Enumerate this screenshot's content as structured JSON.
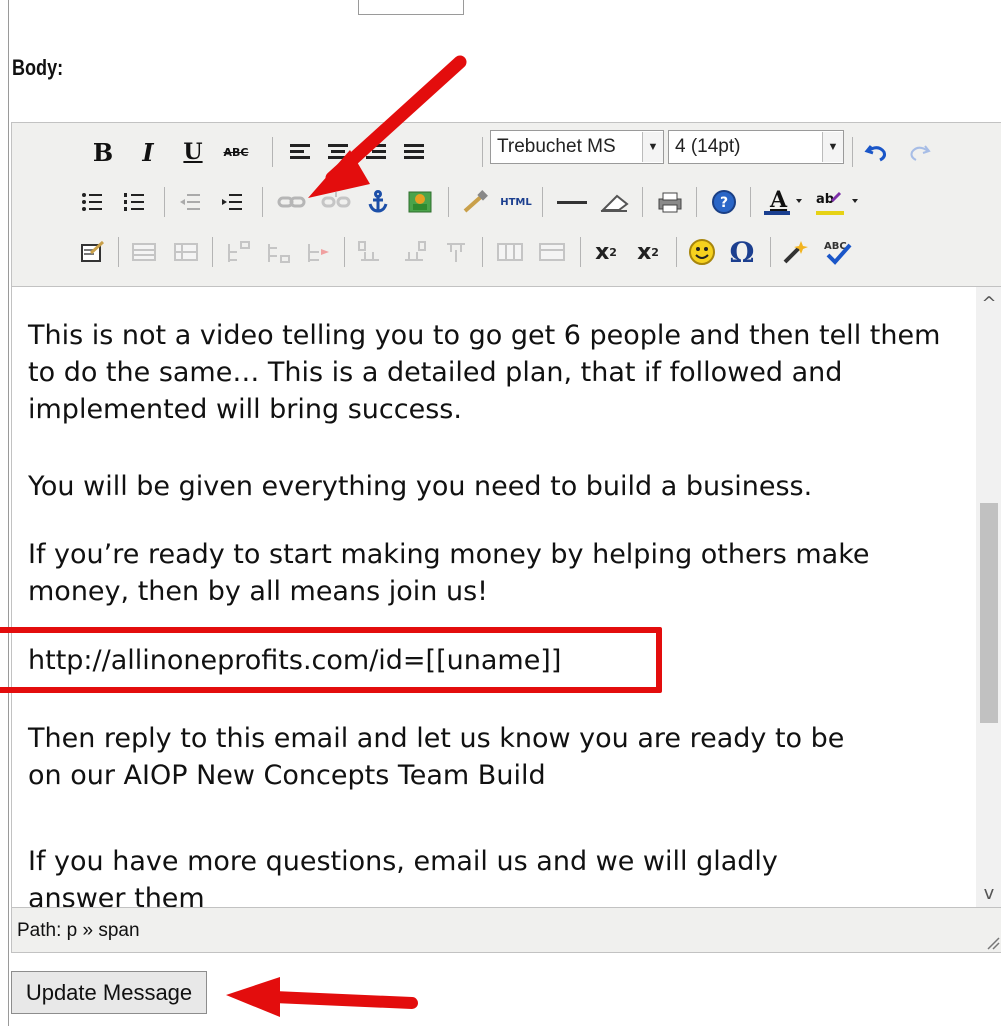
{
  "top": {
    "cut_label": "...",
    "cut_tail": "' ' ' ' (        )"
  },
  "body_label": "Body:",
  "toolbar": {
    "bold": "B",
    "italic": "I",
    "underline": "U",
    "strike": "ABC",
    "font_family": "Trebuchet MS",
    "font_size": "4 (14pt)",
    "html_label": "HTML",
    "abc_label": "ABC"
  },
  "content": {
    "p1": "This is not a video telling you to go get 6 people and then tell them to do the same… This is a detailed plan, that if followed and implemented will bring success.",
    "p2": "You will be given everything you need to build a business.",
    "p3": "If you’re ready to start making money by helping others make money, then by all means join us!",
    "p4": "http://allinoneprofits.com/id=[[uname]]",
    "p5": "Then  reply to this email and let us know you are ready to be on our AIOP New Concepts Team Build",
    "p6": "If you have more questions, email us and we will gladly answer them"
  },
  "path_text": "Path: p » span",
  "update_button": "Update Message",
  "colors": {
    "annotation_red": "#e30d0d"
  }
}
